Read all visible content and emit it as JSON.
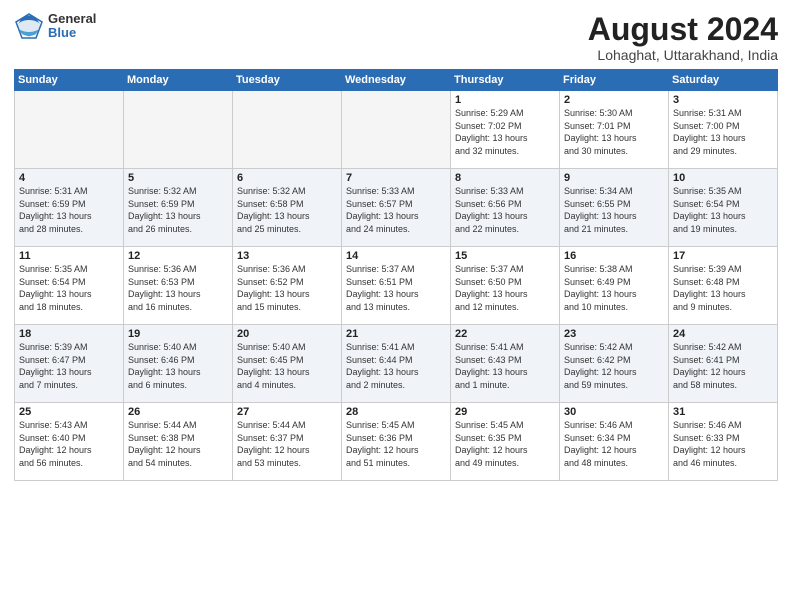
{
  "header": {
    "logo_general": "General",
    "logo_blue": "Blue",
    "month_year": "August 2024",
    "location": "Lohaghat, Uttarakhand, India"
  },
  "weekdays": [
    "Sunday",
    "Monday",
    "Tuesday",
    "Wednesday",
    "Thursday",
    "Friday",
    "Saturday"
  ],
  "weeks": [
    [
      {
        "day": "",
        "info": ""
      },
      {
        "day": "",
        "info": ""
      },
      {
        "day": "",
        "info": ""
      },
      {
        "day": "",
        "info": ""
      },
      {
        "day": "1",
        "info": "Sunrise: 5:29 AM\nSunset: 7:02 PM\nDaylight: 13 hours\nand 32 minutes."
      },
      {
        "day": "2",
        "info": "Sunrise: 5:30 AM\nSunset: 7:01 PM\nDaylight: 13 hours\nand 30 minutes."
      },
      {
        "day": "3",
        "info": "Sunrise: 5:31 AM\nSunset: 7:00 PM\nDaylight: 13 hours\nand 29 minutes."
      }
    ],
    [
      {
        "day": "4",
        "info": "Sunrise: 5:31 AM\nSunset: 6:59 PM\nDaylight: 13 hours\nand 28 minutes."
      },
      {
        "day": "5",
        "info": "Sunrise: 5:32 AM\nSunset: 6:59 PM\nDaylight: 13 hours\nand 26 minutes."
      },
      {
        "day": "6",
        "info": "Sunrise: 5:32 AM\nSunset: 6:58 PM\nDaylight: 13 hours\nand 25 minutes."
      },
      {
        "day": "7",
        "info": "Sunrise: 5:33 AM\nSunset: 6:57 PM\nDaylight: 13 hours\nand 24 minutes."
      },
      {
        "day": "8",
        "info": "Sunrise: 5:33 AM\nSunset: 6:56 PM\nDaylight: 13 hours\nand 22 minutes."
      },
      {
        "day": "9",
        "info": "Sunrise: 5:34 AM\nSunset: 6:55 PM\nDaylight: 13 hours\nand 21 minutes."
      },
      {
        "day": "10",
        "info": "Sunrise: 5:35 AM\nSunset: 6:54 PM\nDaylight: 13 hours\nand 19 minutes."
      }
    ],
    [
      {
        "day": "11",
        "info": "Sunrise: 5:35 AM\nSunset: 6:54 PM\nDaylight: 13 hours\nand 18 minutes."
      },
      {
        "day": "12",
        "info": "Sunrise: 5:36 AM\nSunset: 6:53 PM\nDaylight: 13 hours\nand 16 minutes."
      },
      {
        "day": "13",
        "info": "Sunrise: 5:36 AM\nSunset: 6:52 PM\nDaylight: 13 hours\nand 15 minutes."
      },
      {
        "day": "14",
        "info": "Sunrise: 5:37 AM\nSunset: 6:51 PM\nDaylight: 13 hours\nand 13 minutes."
      },
      {
        "day": "15",
        "info": "Sunrise: 5:37 AM\nSunset: 6:50 PM\nDaylight: 13 hours\nand 12 minutes."
      },
      {
        "day": "16",
        "info": "Sunrise: 5:38 AM\nSunset: 6:49 PM\nDaylight: 13 hours\nand 10 minutes."
      },
      {
        "day": "17",
        "info": "Sunrise: 5:39 AM\nSunset: 6:48 PM\nDaylight: 13 hours\nand 9 minutes."
      }
    ],
    [
      {
        "day": "18",
        "info": "Sunrise: 5:39 AM\nSunset: 6:47 PM\nDaylight: 13 hours\nand 7 minutes."
      },
      {
        "day": "19",
        "info": "Sunrise: 5:40 AM\nSunset: 6:46 PM\nDaylight: 13 hours\nand 6 minutes."
      },
      {
        "day": "20",
        "info": "Sunrise: 5:40 AM\nSunset: 6:45 PM\nDaylight: 13 hours\nand 4 minutes."
      },
      {
        "day": "21",
        "info": "Sunrise: 5:41 AM\nSunset: 6:44 PM\nDaylight: 13 hours\nand 2 minutes."
      },
      {
        "day": "22",
        "info": "Sunrise: 5:41 AM\nSunset: 6:43 PM\nDaylight: 13 hours\nand 1 minute."
      },
      {
        "day": "23",
        "info": "Sunrise: 5:42 AM\nSunset: 6:42 PM\nDaylight: 12 hours\nand 59 minutes."
      },
      {
        "day": "24",
        "info": "Sunrise: 5:42 AM\nSunset: 6:41 PM\nDaylight: 12 hours\nand 58 minutes."
      }
    ],
    [
      {
        "day": "25",
        "info": "Sunrise: 5:43 AM\nSunset: 6:40 PM\nDaylight: 12 hours\nand 56 minutes."
      },
      {
        "day": "26",
        "info": "Sunrise: 5:44 AM\nSunset: 6:38 PM\nDaylight: 12 hours\nand 54 minutes."
      },
      {
        "day": "27",
        "info": "Sunrise: 5:44 AM\nSunset: 6:37 PM\nDaylight: 12 hours\nand 53 minutes."
      },
      {
        "day": "28",
        "info": "Sunrise: 5:45 AM\nSunset: 6:36 PM\nDaylight: 12 hours\nand 51 minutes."
      },
      {
        "day": "29",
        "info": "Sunrise: 5:45 AM\nSunset: 6:35 PM\nDaylight: 12 hours\nand 49 minutes."
      },
      {
        "day": "30",
        "info": "Sunrise: 5:46 AM\nSunset: 6:34 PM\nDaylight: 12 hours\nand 48 minutes."
      },
      {
        "day": "31",
        "info": "Sunrise: 5:46 AM\nSunset: 6:33 PM\nDaylight: 12 hours\nand 46 minutes."
      }
    ]
  ]
}
